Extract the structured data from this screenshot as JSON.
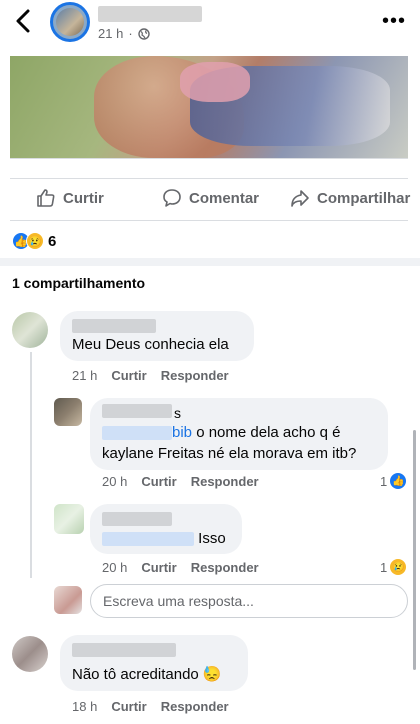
{
  "header": {
    "time": "21 h",
    "audience_icon": "globe-icon",
    "more_label": "•••"
  },
  "actions": {
    "like": "Curtir",
    "comment": "Comentar",
    "share": "Compartilhar"
  },
  "reactions": {
    "types": [
      "like",
      "sad"
    ],
    "count": "6"
  },
  "shares": "1 compartilhamento",
  "comments": [
    {
      "text": "Meu Deus conhecia ela",
      "time": "21 h",
      "like_label": "Curtir",
      "reply_label": "Responder"
    }
  ],
  "replies": [
    {
      "name_suffix": "s",
      "mention_suffix": "bib",
      "text_line1": " o nome dela acho q é",
      "text_line2": "kaylane Freitas né ela morava em itb?",
      "time": "20 h",
      "like_label": "Curtir",
      "reply_label": "Responder",
      "reaction_count": "1",
      "reaction": "like"
    },
    {
      "text": "Isso",
      "time": "20 h",
      "like_label": "Curtir",
      "reply_label": "Responder",
      "reaction_count": "1",
      "reaction": "sad"
    }
  ],
  "reply_input": {
    "placeholder": "Escreva uma resposta..."
  },
  "comment2": {
    "text": "Não tô acreditando 😓",
    "time": "18 h",
    "like_label": "Curtir",
    "reply_label": "Responder"
  },
  "colors": {
    "accent": "#1b74e4",
    "bubble": "#f0f2f5",
    "secondary_text": "#65676b"
  }
}
